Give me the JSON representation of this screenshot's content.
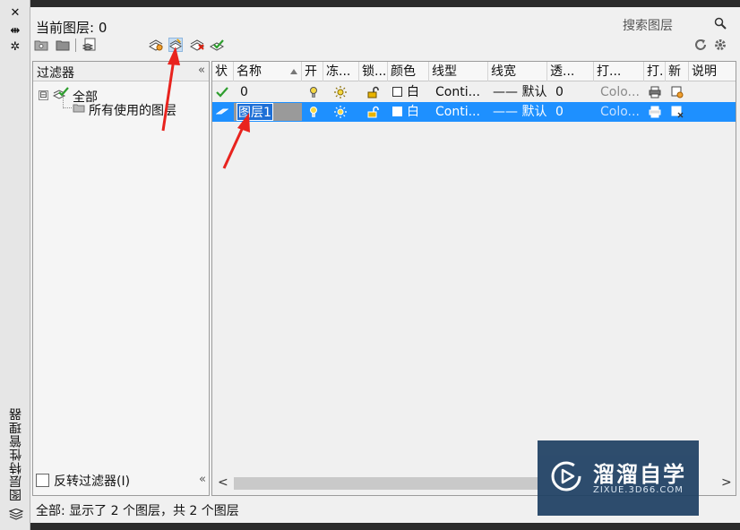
{
  "window": {
    "rail_title": "图层特性管理器",
    "close_glyph": "✕",
    "pin_glyph": "⇹",
    "settings_glyph": "✲"
  },
  "header": {
    "current_layer": "当前图层: 0",
    "search_placeholder": "搜索图层"
  },
  "filter_panel": {
    "header": "过滤器",
    "collapse_glyph": "«",
    "tree": {
      "toggle": "⊟",
      "all_label": "全部",
      "used_label": "所有使用的图层"
    },
    "invert_label": "反转过滤器(I)"
  },
  "grid": {
    "columns": [
      "状",
      "名称",
      "开",
      "冻...",
      "锁...",
      "颜色",
      "线型",
      "线宽",
      "透...",
      "打...",
      "打.",
      "新",
      "说明"
    ],
    "rows": [
      {
        "name": "0",
        "color": "白",
        "linetype": "Conti...",
        "lineweight": "—— 默认",
        "transparency": "0",
        "plot_style": "Colo...",
        "selected": false
      },
      {
        "name": "图层1",
        "color": "白",
        "linetype": "Conti...",
        "lineweight": "—— 默认",
        "transparency": "0",
        "plot_style": "Colo...",
        "selected": true
      }
    ],
    "scroll_left": "<",
    "scroll_right": ">"
  },
  "status_bar": "全部: 显示了 2 个图层，共 2 个图层",
  "watermark": {
    "title": "溜溜自学",
    "subtitle": "ZIXUE.3D66.COM"
  },
  "colors": {
    "selection": "#1e90ff",
    "annotation_arrow": "#e8231e",
    "check_green": "#2e9e2e"
  }
}
